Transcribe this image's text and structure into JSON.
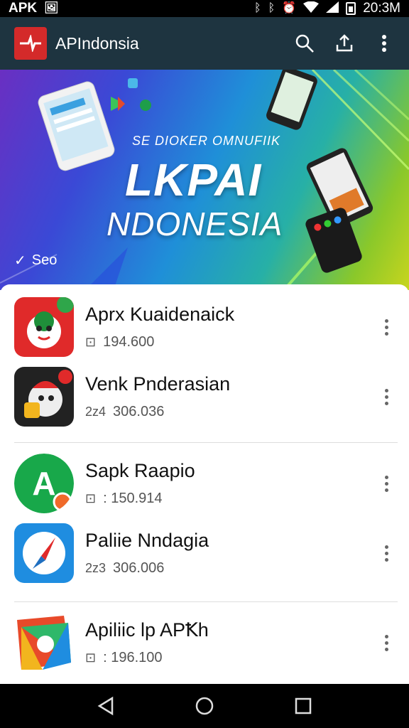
{
  "status_bar": {
    "left_text": "APK",
    "time": "20:3M"
  },
  "app_bar": {
    "title": "APIndonsia"
  },
  "banner": {
    "subtitle": "SE DIOKER OMNUFIIK",
    "title_line1": "LKPAI",
    "title_line2": "NDONESIA",
    "seo_label": "Seo"
  },
  "apps": [
    {
      "name": "Aprx Kuaidenaick",
      "meta": "194.600",
      "meta_icon": "tray-icon",
      "accent": "#e12a2a"
    },
    {
      "name": "Venk Pnderasian",
      "meta": "306.036",
      "meta_prefix": "2ᴢ4",
      "meta_icon": "size-icon",
      "accent": "#222222"
    },
    {
      "name": "Sapk Raapio",
      "meta": ": 150.914",
      "meta_icon": "tray-icon",
      "accent": "#18a84a"
    },
    {
      "name": "Paliie Nndagia",
      "meta": "306.006",
      "meta_prefix": "2ᴢ3",
      "meta_icon": "size-icon",
      "accent": "#1f8de0"
    },
    {
      "name": "Apiliic lp APꝀh",
      "meta": ": 196.100",
      "meta_icon": "tray-icon",
      "accent": "#2fb86a"
    }
  ]
}
